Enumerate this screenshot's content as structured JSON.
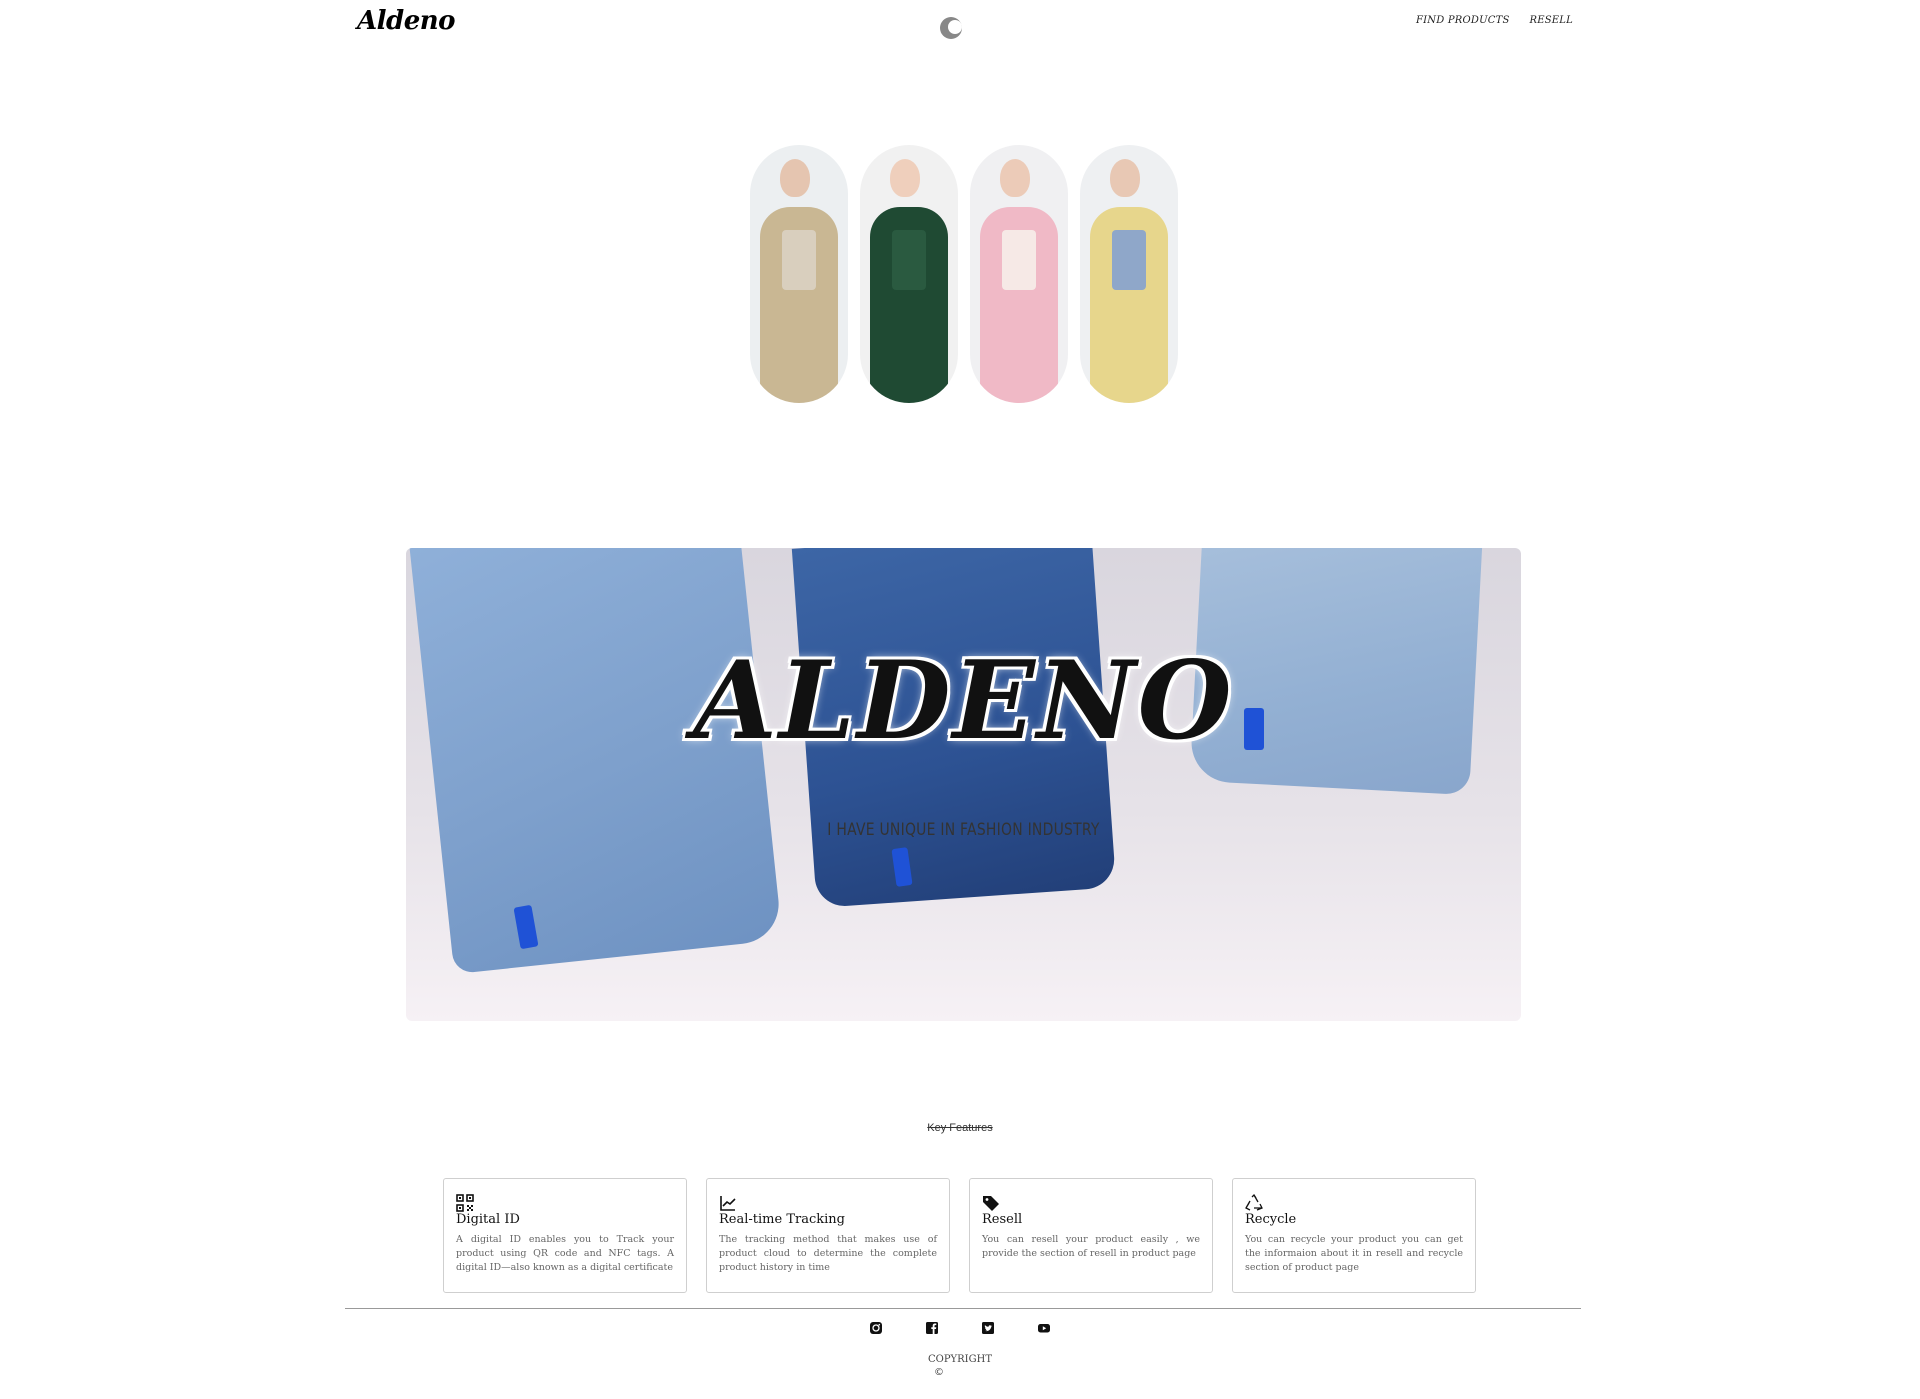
{
  "header": {
    "logo": "Aldeno",
    "theme_toggle_icon": "moon-icon",
    "nav": [
      {
        "label": "FIND PRODUCTS"
      },
      {
        "label": "RESELL"
      }
    ]
  },
  "gallery": {
    "models": [
      {
        "name": "model-beige-blazer",
        "bg": "#eceff1",
        "skin": "#e5c5b0",
        "outfit": "#c9b793",
        "accent": "#d9cfbe"
      },
      {
        "name": "model-green-blazer",
        "bg": "#f1f1f1",
        "skin": "#efcfbc",
        "outfit": "#1f4a33",
        "accent": "#f3efe9"
      },
      {
        "name": "model-pink-suit",
        "bg": "#f0f0f2",
        "skin": "#eccbb8",
        "outfit": "#f0b9c6",
        "accent": "#f6e9e6"
      },
      {
        "name": "model-yellow-blazer",
        "bg": "#eef0f2",
        "skin": "#e8c8b4",
        "outfit": "#e7d68c",
        "accent": "#8fa7c9"
      }
    ]
  },
  "hero": {
    "title": "ALDENO",
    "subtitle": "I HAVE UNIQUE IN FASHION INDUSTRY"
  },
  "features": {
    "title": "Key Features",
    "items": [
      {
        "icon": "qr-code-icon",
        "title": "Digital ID",
        "text": "A digital ID enables you to Track your product using QR code and NFC tags. A digital ID—also known as a digital certificate"
      },
      {
        "icon": "line-chart-icon",
        "title": "Real-time Tracking",
        "text": "The tracking method that makes use of product cloud to determine the complete product history in time"
      },
      {
        "icon": "tag-icon",
        "title": "Resell",
        "text": "You can resell your product easily , we provide the section of resell in product page"
      },
      {
        "icon": "recycle-icon",
        "title": "Recycle",
        "text": "You can recycle your product you can get the informaion about it in resell and recycle section of product page"
      }
    ]
  },
  "footer": {
    "social": [
      "instagram-icon",
      "facebook-icon",
      "twitter-icon",
      "youtube-icon"
    ],
    "copyright": "COPYRIGHT",
    "copyright_symbol": "©"
  }
}
